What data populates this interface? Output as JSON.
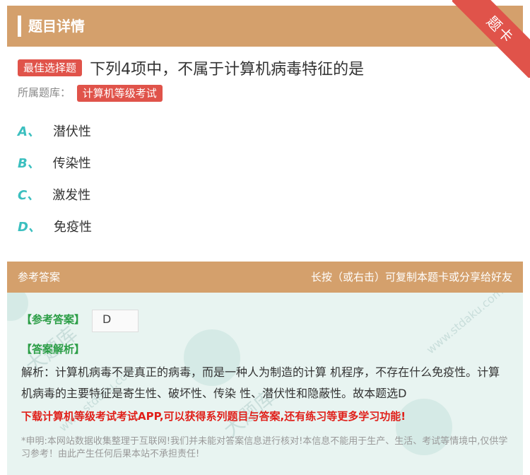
{
  "header": {
    "title": "题目详情",
    "ribbon": "题卡"
  },
  "question": {
    "badge": "最佳选择题",
    "text": "下列4项中，不属于计算机病毒特征的是",
    "source_label": "所属题库：",
    "source_badge": "计算机等级考试"
  },
  "options": [
    {
      "letter": "A、",
      "text": "潜伏性"
    },
    {
      "letter": "B、",
      "text": "传染性"
    },
    {
      "letter": "C、",
      "text": "激发性"
    },
    {
      "letter": "D、",
      "text": "免疫性"
    }
  ],
  "answer_section": {
    "title": "参考答案",
    "hint": "长按（或右击）可复制本题卡或分享给好友",
    "ref_label": "【参考答案】",
    "ref_value": "D",
    "analysis_label": "【答案解析】",
    "analysis": "解析：计算机病毒不是真正的病毒，而是一种人为制造的计算 机程序，不存在什么免疫性。计算机病毒的主要特征是寄生性、破坏性、传染 性、潜伏性和隐蔽性。故本题选D",
    "promo": "下载计算机等级考试考试APP,可以获得系列题目与答案,还有练习等更多学习功能!",
    "disclaimer": "*申明:本网站数据收集整理于互联网!我们并未能对答案信息进行核对!本信息不能用于生产、生活、考试等情境中,仅供学习参考！由此产生任何后果本站不承担责任!"
  },
  "watermark": {
    "text": "大题库",
    "url": "www.stdaku.com"
  },
  "colors": {
    "header": "#d4a06c",
    "badge": "#e0534a",
    "letter": "#3bbfbf",
    "answer_bg": "#e8f4f1",
    "promo": "#e0201a",
    "green_label": "#2a9d45"
  }
}
